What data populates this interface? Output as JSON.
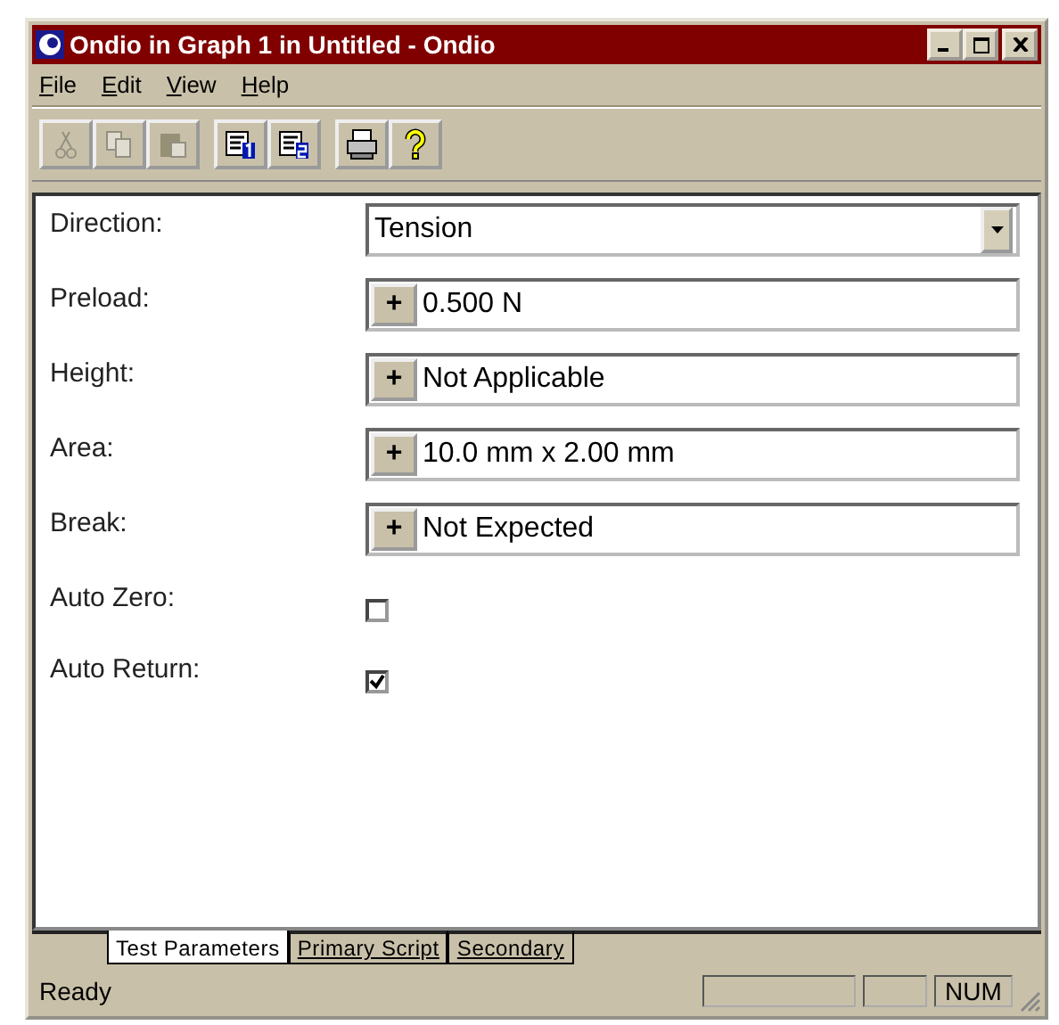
{
  "window": {
    "title": "Ondio in Graph 1 in Untitled - Ondio"
  },
  "menu": [
    "File",
    "Edit",
    "View",
    "Help"
  ],
  "toolbar": [
    {
      "kind": "cut",
      "disabled": true
    },
    {
      "kind": "copy",
      "disabled": true
    },
    {
      "kind": "paste",
      "disabled": true
    },
    {
      "kind": "sheet1",
      "disabled": false
    },
    {
      "kind": "sheet2",
      "disabled": false
    },
    {
      "kind": "print",
      "disabled": false
    },
    {
      "kind": "help",
      "disabled": false
    }
  ],
  "fields": [
    {
      "kind": "dropdown",
      "label": "Direction:",
      "value": "Tension"
    },
    {
      "kind": "stepper",
      "label": "Preload:",
      "value": "0.500 N",
      "button": "+"
    },
    {
      "kind": "stepper",
      "label": "Height:",
      "value": "Not Applicable",
      "button": "+"
    },
    {
      "kind": "stepper",
      "label": "Area:",
      "value": "10.0 mm x 2.00 mm",
      "button": "+"
    },
    {
      "kind": "stepper",
      "label": "Break:",
      "value": "Not Expected",
      "button": "+"
    },
    {
      "kind": "checkbox",
      "label": "Auto Zero:",
      "checked": false
    },
    {
      "kind": "checkbox",
      "label": "Auto Return:",
      "checked": true
    }
  ],
  "tabs": [
    {
      "label": "Test Parameters",
      "selected": true
    },
    {
      "label": "Primary Script",
      "selected": false
    },
    {
      "label": "Secondary",
      "selected": false
    }
  ],
  "status_bar": {
    "text": "Ready",
    "indicator": "NUM"
  }
}
